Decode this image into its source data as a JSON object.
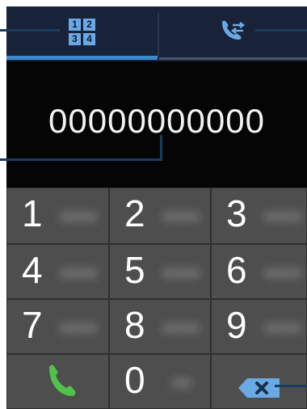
{
  "tabs": [
    {
      "name": "keypad",
      "icon": "keypad-icon",
      "tile": [
        "1",
        "2",
        "3",
        "4"
      ],
      "active": true
    },
    {
      "name": "logs",
      "icon": "call-log-icon",
      "active": false
    }
  ],
  "display": {
    "number": "00000000000"
  },
  "keys": [
    {
      "digit": "1"
    },
    {
      "digit": "2"
    },
    {
      "digit": "3"
    },
    {
      "digit": "4"
    },
    {
      "digit": "5"
    },
    {
      "digit": "6"
    },
    {
      "digit": "7"
    },
    {
      "digit": "8"
    },
    {
      "digit": "9"
    },
    {
      "icon": "phone-call-icon"
    },
    {
      "digit": "0"
    },
    {
      "icon": "backspace-icon"
    }
  ],
  "colors": {
    "tab_bg": "#18233a",
    "tab_accent": "#3b8bd1",
    "keypad_tile": "#6aa9e4",
    "call_green": "#4fc24a",
    "key_bg": "#4e4e4e",
    "callout_line": "#1a3c5e"
  }
}
